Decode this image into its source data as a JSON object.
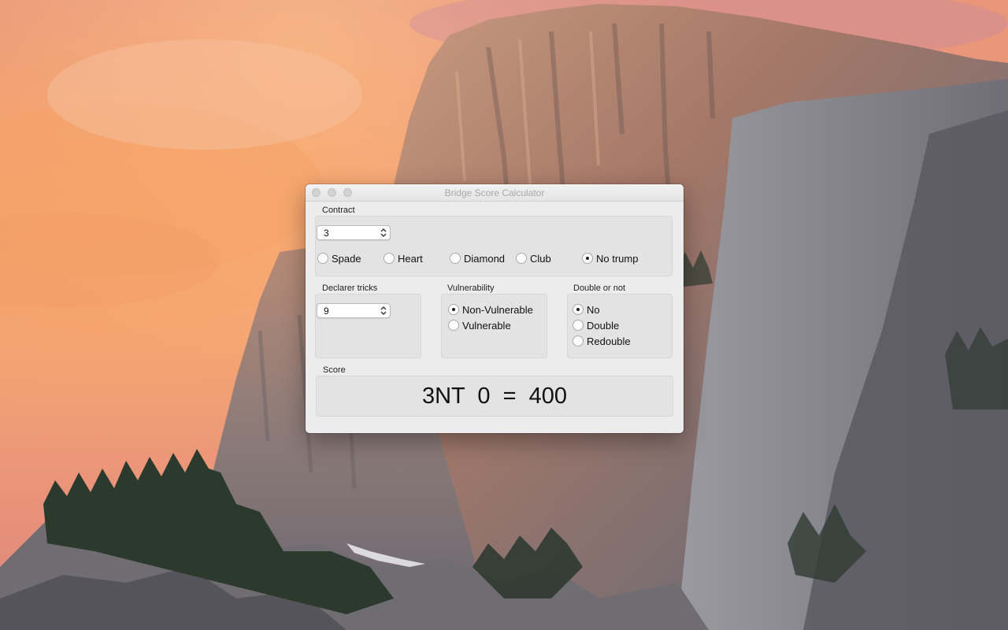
{
  "window": {
    "title": "Bridge Score Calculator"
  },
  "contract": {
    "label": "Contract",
    "level": "3",
    "suits": [
      {
        "label": "Spade",
        "selected": false
      },
      {
        "label": "Heart",
        "selected": false
      },
      {
        "label": "Diamond",
        "selected": false
      },
      {
        "label": "Club",
        "selected": false
      },
      {
        "label": "No trump",
        "selected": true
      }
    ]
  },
  "declarer": {
    "label": "Declarer tricks",
    "tricks": "9"
  },
  "vulnerability": {
    "label": "Vulnerability",
    "options": [
      {
        "label": "Non-Vulnerable",
        "selected": true
      },
      {
        "label": "Vulnerable",
        "selected": false
      }
    ]
  },
  "doubling": {
    "label": "Double or not",
    "options": [
      {
        "label": "No",
        "selected": true
      },
      {
        "label": "Double",
        "selected": false
      },
      {
        "label": "Redouble",
        "selected": false
      }
    ]
  },
  "score": {
    "label": "Score",
    "result": "3NT  0  =  400"
  },
  "colors": {
    "sky_top": "#e8957a",
    "sky_glow": "#f2a06a",
    "granite_light": "#8d8c92",
    "granite_dark": "#4a4a52",
    "forest": "#2c3a2e"
  }
}
